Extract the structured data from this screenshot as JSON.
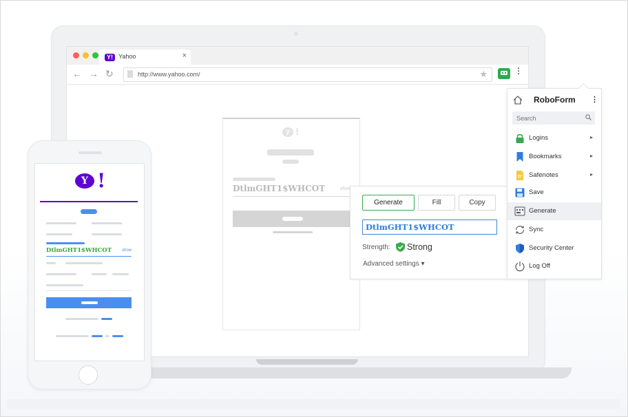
{
  "browser": {
    "tab_title": "Yahoo",
    "tab_favicon": "Y!",
    "tab_close": "×",
    "url": "http://www.yahoo.com/",
    "back_icon": "←",
    "forward_icon": "→",
    "reload_icon": "↻",
    "star_icon": "★",
    "menu_icon": "⋮",
    "traffic_lights": [
      "#ff5f57",
      "#febc2e",
      "#28c840"
    ]
  },
  "laptop_page": {
    "logo": "y",
    "logo_exclaim": "!",
    "password": "DtlmGHT1$WHCOT",
    "show_label": "show"
  },
  "generator": {
    "generate_label": "Generate",
    "fill_label": "Fill",
    "copy_label": "Copy",
    "password": "DtlmGHT1$WHCOT",
    "strength_label": "Strength:",
    "strength_value": "Strong",
    "advanced_label": "Advanced settings ▾",
    "accent_color": "#39a94f",
    "field_color": "#3f86d8"
  },
  "roboform": {
    "title": "RoboForm",
    "menu_icon": "⋮",
    "search_placeholder": "Search",
    "items": [
      {
        "label": "Logins",
        "icon": "lock-icon",
        "has_submenu": true,
        "arrow": "▸"
      },
      {
        "label": "Bookmarks",
        "icon": "bookmark-icon",
        "has_submenu": true,
        "arrow": "▸"
      },
      {
        "label": "Safenotes",
        "icon": "note-icon",
        "has_submenu": true,
        "arrow": "▸"
      },
      {
        "label": "Save",
        "icon": "floppy-icon",
        "has_submenu": false
      },
      {
        "label": "Generate",
        "icon": "generate-icon",
        "has_submenu": false,
        "active": true
      },
      {
        "label": "Sync",
        "icon": "sync-icon",
        "has_submenu": false
      },
      {
        "label": "Security Center",
        "icon": "shield-icon",
        "has_submenu": false
      },
      {
        "label": "Log Off",
        "icon": "power-icon",
        "has_submenu": false
      }
    ]
  },
  "phone_page": {
    "logo": "Y",
    "logo_exclaim": "!",
    "password": "DtlmGHT1$WHCOT",
    "show_label": "show",
    "brand_color": "#5f01d1"
  }
}
